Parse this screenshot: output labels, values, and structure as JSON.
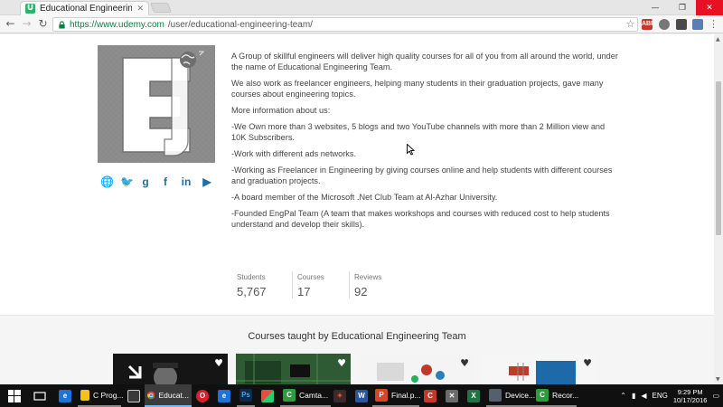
{
  "browser": {
    "tab_title": "Educational Engineering",
    "tab_icon": "U",
    "url_secure": "https://www.udemy.com",
    "url_path": "/user/educational-engineering-team/",
    "extensions": [
      "ABP",
      "",
      "",
      ""
    ]
  },
  "profile": {
    "bio": [
      "A Group of skillful engineers will deliver high quality courses for all of you from all around the world, under the name of Educational Engineering Team.",
      "We also work as freelancer engineers, helping many students in their graduation projects, gave many courses about engineering topics.",
      "More information about us:",
      "-We Own more than 3 websites, 5 blogs and two YouTube channels with more than 2 Million view and 10K Subscribers.",
      "-Work with different ads networks.",
      "-Working as Freelancer in Engineering by giving courses online and help students with different courses and graduation projects.",
      "-A board member of the Microsoft .Net Club Team at Al-Azhar University.",
      "-Founded EngPal Team (A team that makes workshops and courses with reduced cost to help students understand and develop their skills)."
    ],
    "socials": [
      "globe-icon",
      "twitter-icon",
      "google-plus-icon",
      "facebook-icon",
      "linkedin-icon",
      "youtube-icon"
    ],
    "socials_glyphs": [
      "🌐",
      "🐦",
      "g",
      "f",
      "in",
      "▶"
    ],
    "stats": [
      {
        "label": "Students",
        "value": "5,767"
      },
      {
        "label": "Courses",
        "value": "17"
      },
      {
        "label": "Reviews",
        "value": "92"
      }
    ]
  },
  "courses": {
    "heading": "Courses taught by Educational Engineering Team"
  },
  "taskbar": {
    "items": [
      {
        "label": "C Prog...",
        "color": "#f0c419"
      },
      {
        "label": "Educat...",
        "color": "#e94235"
      },
      {
        "label": "Camta...",
        "color": "#2a9d3f"
      },
      {
        "label": "Final.p...",
        "color": "#d24726"
      },
      {
        "label": "Device...",
        "color": "#555f6d"
      },
      {
        "label": "Recor...",
        "color": "#2a9d3f"
      }
    ],
    "lang": "ENG",
    "time": "9:29 PM",
    "date": "10/17/2016"
  },
  "colors": {
    "link_blue": "#1d6fa5",
    "udemy_green": "#2cb26b"
  }
}
